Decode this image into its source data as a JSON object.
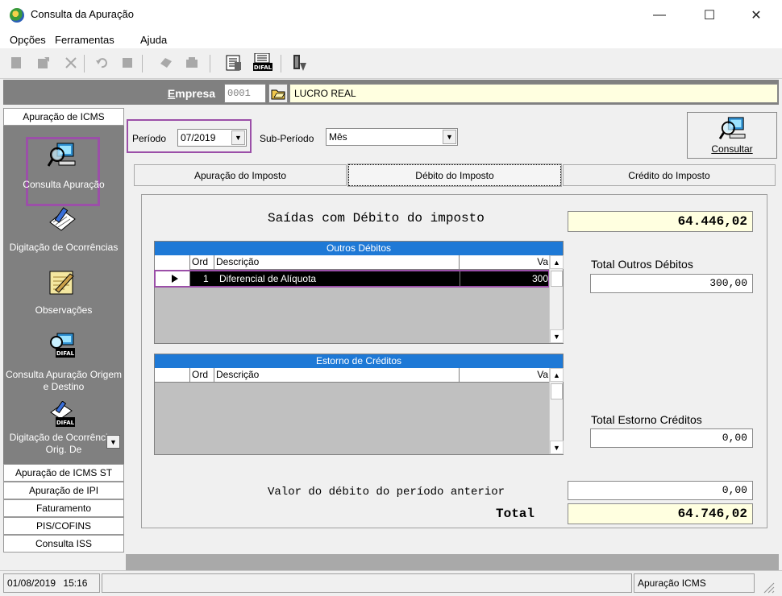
{
  "window": {
    "title": "Consulta da Apuração",
    "minimize": "—",
    "maximize": "☐",
    "close": "✕"
  },
  "menu": {
    "items": [
      "Opções",
      "Ferramentas",
      "Ajuda"
    ]
  },
  "toolbar": {
    "icons": [
      "new-icon",
      "edit-icon",
      "delete-icon",
      "undo-icon",
      "stop-icon",
      "print-icon",
      "print-preview-icon",
      "report-icon",
      "difal-icon",
      "exit-icon"
    ]
  },
  "empresa": {
    "label": "Empresa",
    "code": "0001",
    "name": "LUCRO REAL"
  },
  "nav": {
    "header": "Apuração de ICMS",
    "items": [
      {
        "label": "Consulta Apuração"
      },
      {
        "label": "Digitação de Ocorrências"
      },
      {
        "label": "Observações"
      },
      {
        "label": "Consulta Apuração Origem e Destino"
      },
      {
        "label": "Digitação de Ocorrências Orig. De"
      }
    ],
    "difal_badge": "DIFAL",
    "buttons": [
      "Apuração de ICMS ST",
      "Apuração de IPI",
      "Faturamento",
      "PIS/COFINS",
      "Consulta ISS"
    ]
  },
  "filters": {
    "periodo_label": "Período",
    "periodo_value": "07/2019",
    "subperiodo_label": "Sub-Período",
    "subperiodo_value": "Mês"
  },
  "consultar_label": "Consultar",
  "tabs": [
    "Apuração do Imposto",
    "Débito do Imposto",
    "Crédito do Imposto"
  ],
  "debito": {
    "saidas_label": "Saídas com Débito do imposto",
    "saidas_value": "64.446,02",
    "outros": {
      "caption": "Outros Débitos",
      "columns": [
        "Ord",
        "Descrição",
        "Va"
      ],
      "rows": [
        {
          "ord": "1",
          "descricao": "Diferencial de Alíquota",
          "valor": "300"
        }
      ]
    },
    "total_outros_label": "Total Outros Débitos",
    "total_outros_value": "300,00",
    "estorno": {
      "caption": "Estorno de Créditos",
      "columns": [
        "Ord",
        "Descrição",
        "Va"
      ]
    },
    "total_estorno_label": "Total Estorno Créditos",
    "total_estorno_value": "0,00",
    "anterior_label": "Valor do débito do período anterior",
    "anterior_value": "0,00",
    "total_label": "Total",
    "total_value": "64.746,02"
  },
  "status": {
    "date": "01/08/2019",
    "time": "15:16",
    "module": "Apuração ICMS"
  }
}
